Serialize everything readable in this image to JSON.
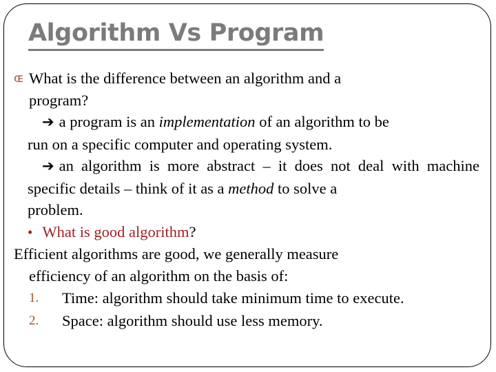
{
  "slide": {
    "title": "Algorithm Vs Program",
    "frame": {
      "border_color": "#000000",
      "radius": "34px"
    },
    "colors": {
      "title_gray": "#7b7b7b",
      "bullet_copper": "#a0522d",
      "heading_red": "#a02020",
      "body_black": "#000000"
    },
    "body": {
      "question": {
        "bullet_icon": "wingding-curl-bullet",
        "bullet_glyph": "ɶ",
        "line1": "What is the difference between an algorithm and a",
        "line2": "program?"
      },
      "point_program": {
        "arrow_icon": "right-arrow-icon",
        "arrow_glyph": "➔",
        "text_before_italic": "a program is an ",
        "italic_word": "implementation",
        "text_after_italic": " of an algorithm to be",
        "line2": "run on a specific computer and operating system."
      },
      "point_algorithm": {
        "arrow_icon": "right-arrow-icon",
        "arrow_glyph": "➔",
        "line1": "an algorithm is more abstract – it does not deal with",
        "line2_before_italic": "machine specific details – think of it as a ",
        "italic_word": "method",
        "line2_after_italic": " to solve a",
        "line3": "problem."
      },
      "good_algorithm": {
        "bullet_icon": "round-bullet-icon",
        "bullet_glyph": "•",
        "red_text": "What is good algorithm",
        "question_mark": "?"
      },
      "efficiency": {
        "line1": "Efficient algorithms are good, we generally measure",
        "line2": "efficiency of an algorithm on the basis of:"
      },
      "numbered_items": [
        {
          "marker": "1.",
          "text": "Time: algorithm should take minimum time to execute."
        },
        {
          "marker": "2.",
          "text": "Space: algorithm should use less memory."
        }
      ]
    }
  }
}
